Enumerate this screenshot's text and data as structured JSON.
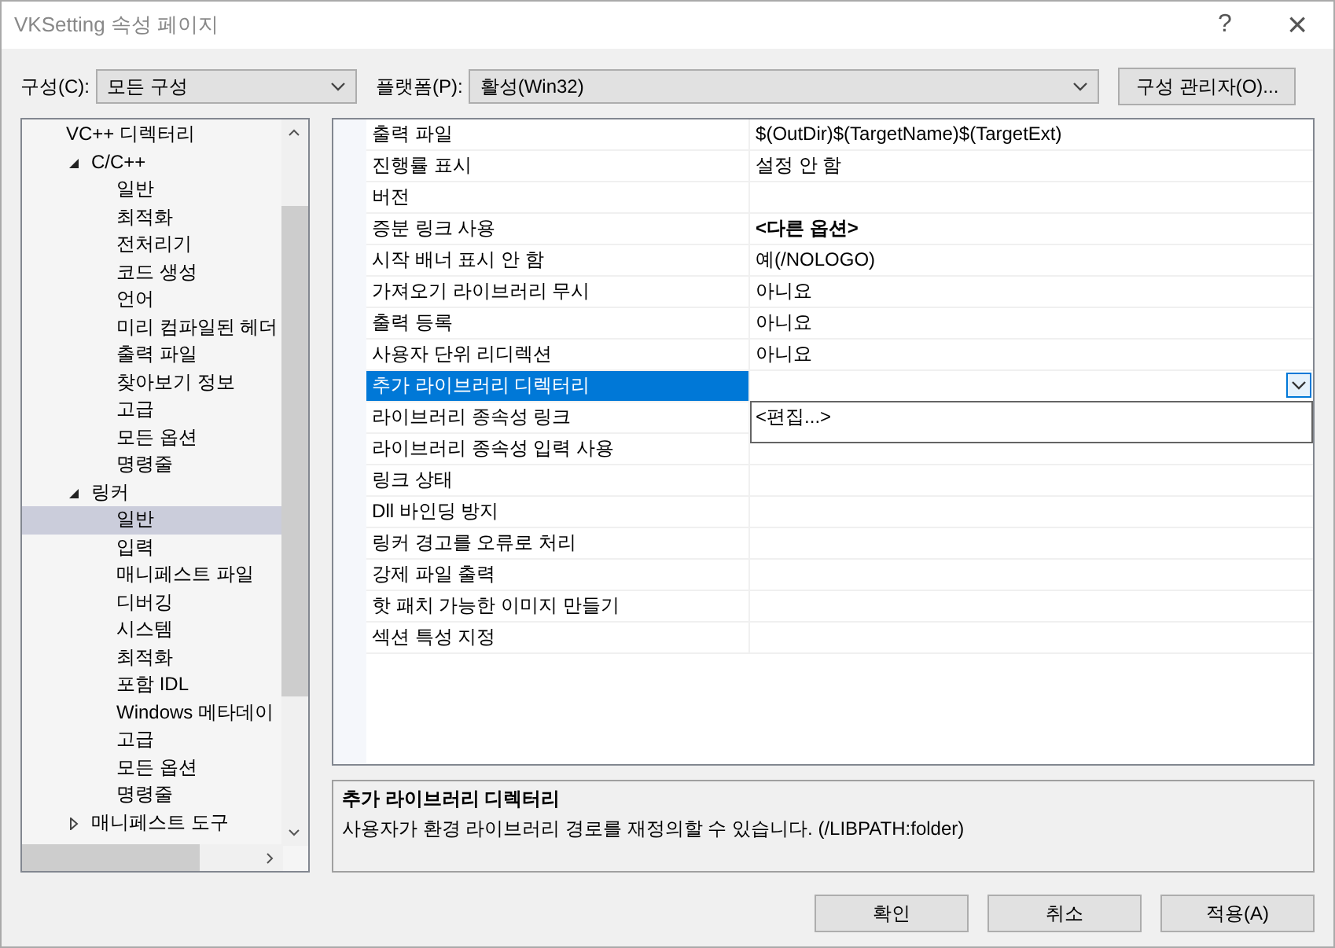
{
  "window": {
    "title": "VKSetting 속성 페이지",
    "help": "?",
    "close": "×"
  },
  "toolbar": {
    "configuration_label": "구성(C):",
    "configuration": "모든 구성",
    "platform_label": "플랫폼(P):",
    "platform": "활성(Win32)",
    "manager_button": "구성 관리자(O)..."
  },
  "tree": [
    {
      "label": "VC++ 디렉터리",
      "selected": false
    },
    {
      "label": "C/C++",
      "selected": false,
      "expanded": true,
      "children": [
        {
          "label": "일반",
          "selected": false
        },
        {
          "label": "최적화",
          "selected": false
        },
        {
          "label": "전처리기",
          "selected": false
        },
        {
          "label": "코드 생성",
          "selected": false
        },
        {
          "label": "언어",
          "selected": false
        },
        {
          "label": "미리 컴파일된 헤더",
          "selected": false
        },
        {
          "label": "출력 파일",
          "selected": false
        },
        {
          "label": "찾아보기 정보",
          "selected": false
        },
        {
          "label": "고급",
          "selected": false
        },
        {
          "label": "모든 옵션",
          "selected": false
        },
        {
          "label": "명령줄",
          "selected": false
        }
      ]
    },
    {
      "label": "링커",
      "selected": false,
      "expanded": true,
      "children": [
        {
          "label": "일반",
          "selected": true
        },
        {
          "label": "입력",
          "selected": false
        },
        {
          "label": "매니페스트 파일",
          "selected": false
        },
        {
          "label": "디버깅",
          "selected": false
        },
        {
          "label": "시스템",
          "selected": false
        },
        {
          "label": "최적화",
          "selected": false
        },
        {
          "label": "포함 IDL",
          "selected": false
        },
        {
          "label": "Windows 메타데이",
          "selected": false
        },
        {
          "label": "고급",
          "selected": false
        },
        {
          "label": "모든 옵션",
          "selected": false
        },
        {
          "label": "명령줄",
          "selected": false
        }
      ]
    },
    {
      "label": "매니페스트 도구",
      "selected": false,
      "expanded": false
    }
  ],
  "properties": [
    {
      "name": "출력 파일",
      "value": "$(OutDir)$(TargetName)$(TargetExt)",
      "selected": false
    },
    {
      "name": "진행률 표시",
      "value": "설정 안 함",
      "selected": false
    },
    {
      "name": "버전",
      "selected": false
    },
    {
      "name": "증분 링크 사용",
      "value": "<다른 옵션>",
      "bold": true,
      "selected": false
    },
    {
      "name": "시작 배너 표시 안 함",
      "value": "예(/NOLOGO)",
      "selected": false
    },
    {
      "name": "가져오기 라이브러리 무시",
      "value": "아니요",
      "selected": false
    },
    {
      "name": "출력 등록",
      "value": "아니요",
      "selected": false
    },
    {
      "name": "사용자 단위 리디렉션",
      "value": "아니요",
      "selected": false
    },
    {
      "name": "추가 라이브러리 디렉터리",
      "selected": true
    },
    {
      "name": "라이브러리 종속성 링크",
      "selected": false
    },
    {
      "name": "라이브러리 종속성 입력 사용",
      "selected": false
    },
    {
      "name": "링크 상태",
      "selected": false
    },
    {
      "name": "Dll 바인딩 방지",
      "selected": false
    },
    {
      "name": "링커 경고를 오류로 처리",
      "selected": false
    },
    {
      "name": "강제 파일 출력",
      "selected": false
    },
    {
      "name": "핫 패치 가능한 이미지 만들기",
      "selected": false
    },
    {
      "name": "섹션 특성 지정",
      "selected": false
    }
  ],
  "dropdown": {
    "options": [
      "<편집...>"
    ]
  },
  "description": {
    "title": "추가 라이브러리 디렉터리",
    "text": "사용자가 환경 라이브러리 경로를 재정의할 수 있습니다. (/LIBPATH:folder)"
  },
  "buttons": [
    "확인",
    "취소",
    "적용(A)"
  ]
}
